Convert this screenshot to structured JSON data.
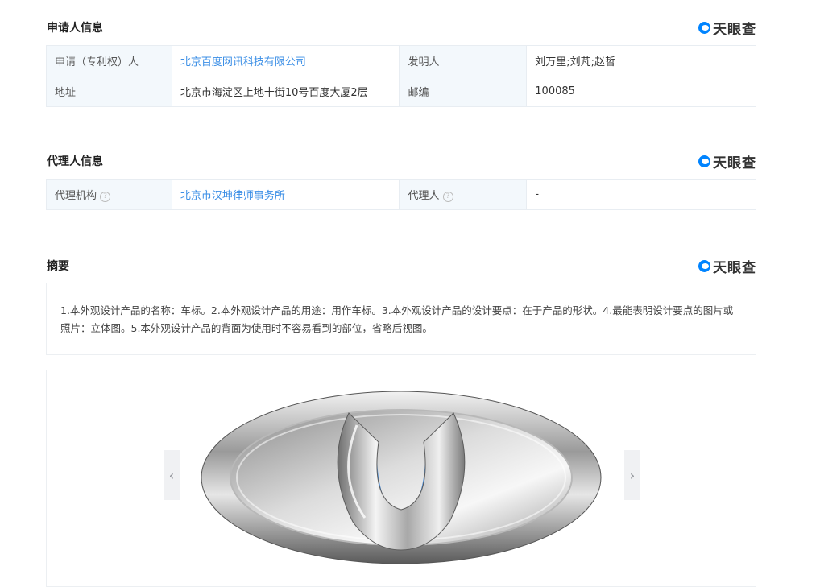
{
  "applicant": {
    "title": "申请人信息",
    "rows": [
      [
        "申请（专利权）人",
        "北京百度网讯科技有限公司",
        "发明人",
        "刘万里;刘芃;赵哲"
      ],
      [
        "地址",
        "北京市海淀区上地十街10号百度大厦2层",
        "邮编",
        "100085"
      ]
    ]
  },
  "agent": {
    "title": "代理人信息",
    "org_label": "代理机构",
    "org_value": "北京市汉坤律师事务所",
    "person_label": "代理人",
    "person_value": "-"
  },
  "abstract": {
    "title": "摘要",
    "text": "1.本外观设计产品的名称：车标。2.本外观设计产品的用途：用作车标。3.本外观设计产品的设计要点：在于产品的形状。4.最能表明设计要点的图片或照片：立体图。5.本外观设计产品的背面为使用时不容易看到的部位，省略后视图。"
  },
  "brand": {
    "name": "天眼查",
    "color": "#0084ff"
  },
  "gallery": {
    "prev_icon": "‹",
    "next_icon": "›"
  },
  "colors": {
    "link": "#3a8ee6",
    "label_bg": "#f3f8fc",
    "border": "#e8edf2",
    "emblem_blue": "#2f7ed8"
  }
}
